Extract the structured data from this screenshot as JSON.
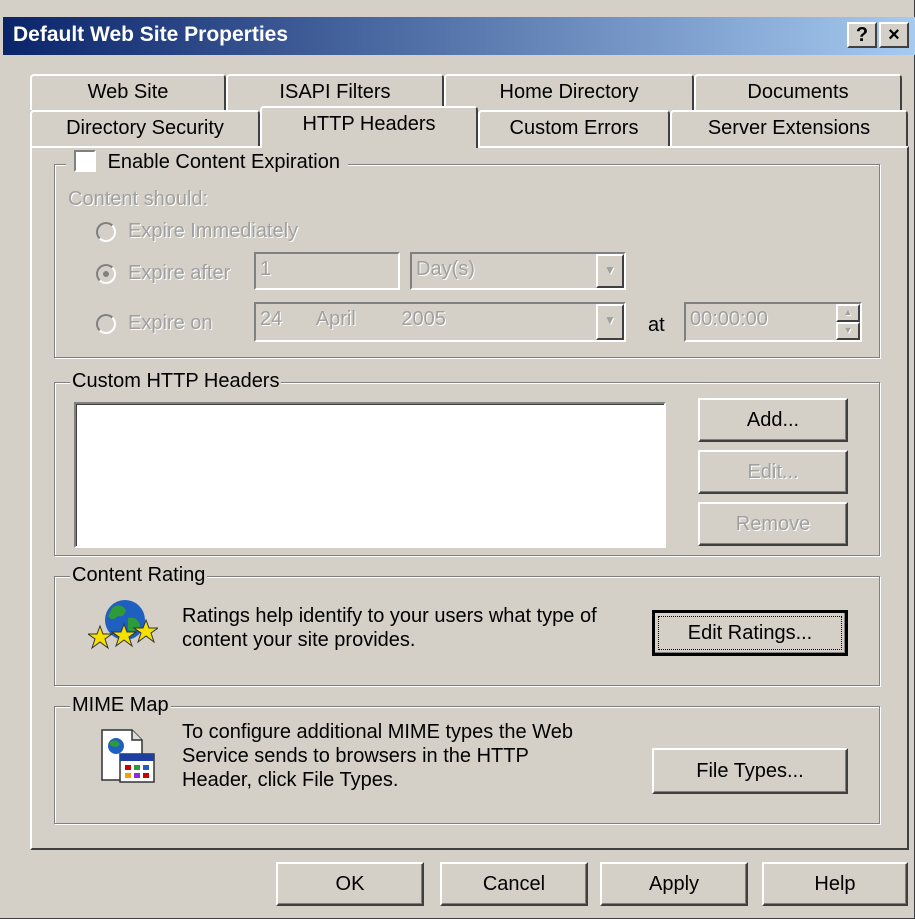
{
  "window": {
    "title": "Default Web Site Properties",
    "help_button": "?",
    "close_button": "×"
  },
  "tabs_back": [
    "Web Site",
    "ISAPI Filters",
    "Home Directory",
    "Documents"
  ],
  "tabs_front": [
    "Directory Security",
    "HTTP Headers",
    "Custom Errors",
    "Server Extensions"
  ],
  "active_tab": "HTTP Headers",
  "expiration": {
    "checkbox_label": "Enable Content Expiration",
    "checked": false,
    "content_should": "Content should:",
    "expire_immediately": "Expire Immediately",
    "expire_after": "Expire after",
    "expire_after_value": "1",
    "expire_after_unit": "Day(s)",
    "expire_on": "Expire on",
    "expire_on_day": "24",
    "expire_on_month": "April",
    "expire_on_year": "2005",
    "at_label": "at",
    "time_value": "00:00:00"
  },
  "custom_headers": {
    "legend": "Custom HTTP Headers",
    "add": "Add...",
    "edit": "Edit...",
    "remove": "Remove"
  },
  "content_rating": {
    "legend": "Content Rating",
    "text_line1": "Ratings help identify to your users what type of",
    "text_line2": "content your site provides.",
    "edit_ratings": "Edit Ratings..."
  },
  "mime_map": {
    "legend": "MIME Map",
    "text_line1": "To configure additional MIME types the Web",
    "text_line2": "Service sends to browsers in the HTTP",
    "text_line3": "Header, click File Types.",
    "file_types": "File Types..."
  },
  "footer": {
    "ok": "OK",
    "cancel": "Cancel",
    "apply": "Apply",
    "help": "Help"
  },
  "icons": {
    "rating": "globe-stars-icon",
    "mime": "mime-document-icon"
  }
}
